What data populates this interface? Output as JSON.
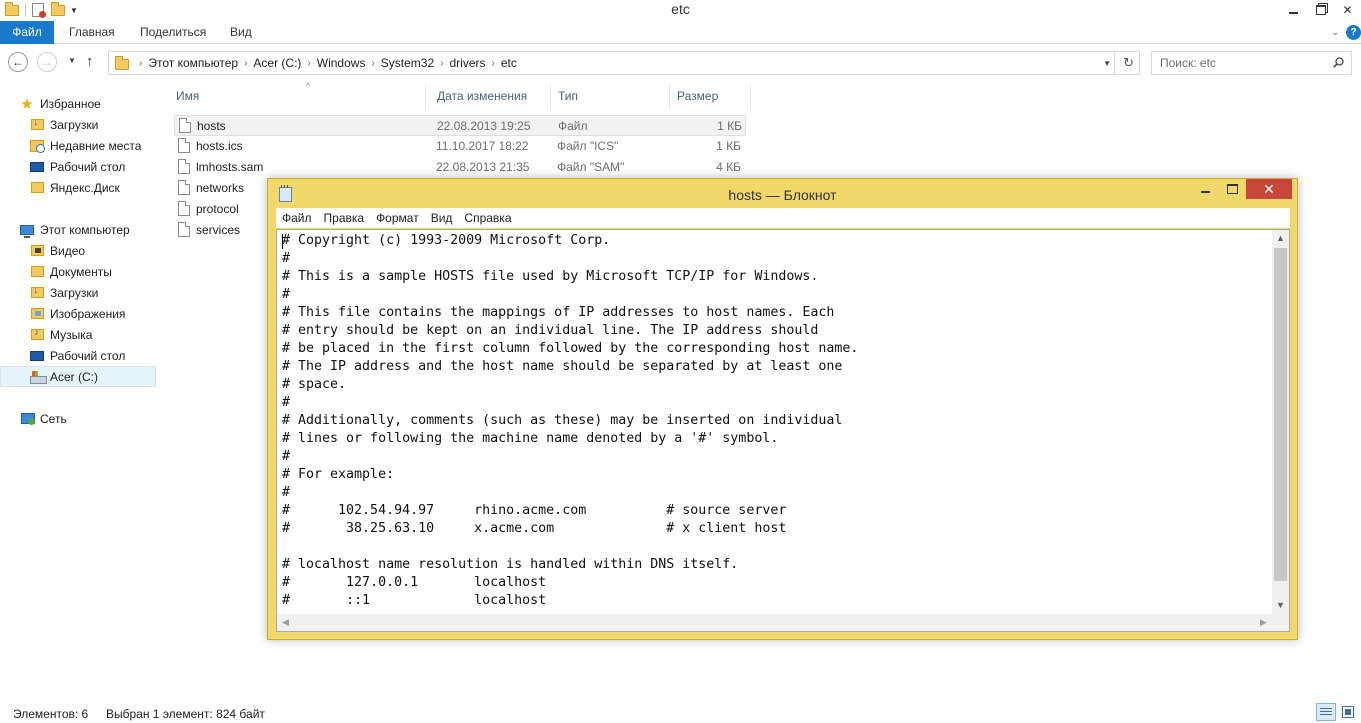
{
  "explorer": {
    "title": "etc",
    "ribbon_tabs": [
      "Файл",
      "Главная",
      "Поделиться",
      "Вид"
    ],
    "breadcrumbs": [
      "Этот компьютер",
      "Acer (C:)",
      "Windows",
      "System32",
      "drivers",
      "etc"
    ],
    "search_placeholder": "Поиск: etc",
    "nav": {
      "favorites": {
        "label": "Избранное",
        "items": [
          "Загрузки",
          "Недавние места",
          "Рабочий стол",
          "Яндекс.Диск"
        ]
      },
      "computer": {
        "label": "Этот компьютер",
        "items": [
          "Видео",
          "Документы",
          "Загрузки",
          "Изображения",
          "Музыка",
          "Рабочий стол",
          "Acer (C:)"
        ]
      },
      "network": {
        "label": "Сеть"
      }
    },
    "columns": {
      "name": "Имя",
      "date": "Дата изменения",
      "type": "Тип",
      "size": "Размер"
    },
    "files": [
      {
        "name": "hosts",
        "date": "22.08.2013 19:25",
        "type": "Файл",
        "size": "1 КБ"
      },
      {
        "name": "hosts.ics",
        "date": "11.10.2017 18:22",
        "type": "Файл \"ICS\"",
        "size": "1 КБ"
      },
      {
        "name": "lmhosts.sam",
        "date": "22.08.2013 21:35",
        "type": "Файл \"SAM\"",
        "size": "4 КБ"
      },
      {
        "name": "networks",
        "date": "",
        "type": "",
        "size": ""
      },
      {
        "name": "protocol",
        "date": "",
        "type": "",
        "size": ""
      },
      {
        "name": "services",
        "date": "",
        "type": "",
        "size": ""
      }
    ],
    "status": {
      "items": "Элементов: 6",
      "selected": "Выбран 1 элемент: 824 байт"
    }
  },
  "notepad": {
    "title": "hosts — Блокнот",
    "menu": [
      "Файл",
      "Правка",
      "Формат",
      "Вид",
      "Справка"
    ],
    "lines": [
      "# Copyright (c) 1993-2009 Microsoft Corp.",
      "#",
      "# This is a sample HOSTS file used by Microsoft TCP/IP for Windows.",
      "#",
      "# This file contains the mappings of IP addresses to host names. Each",
      "# entry should be kept on an individual line. The IP address should",
      "# be placed in the first column followed by the corresponding host name.",
      "# The IP address and the host name should be separated by at least one",
      "# space.",
      "#",
      "# Additionally, comments (such as these) may be inserted on individual",
      "# lines or following the machine name denoted by a '#' symbol.",
      "#",
      "# For example:",
      "#",
      "#      102.54.94.97     rhino.acme.com          # source server",
      "#       38.25.63.10     x.acme.com              # x client host",
      "",
      "# localhost name resolution is handled within DNS itself.",
      "#\t127.0.0.1       localhost",
      "#\t::1             localhost"
    ]
  },
  "icons": {
    "favorites": "star-icon",
    "computer": "computer-icon",
    "network": "network-icon",
    "file": "document-icon",
    "notepad": "notepad-icon"
  },
  "colors": {
    "ribbon_file_tab": "#1979ca",
    "notepad_frame": "#f0d86a",
    "close_button": "#c7473a"
  }
}
